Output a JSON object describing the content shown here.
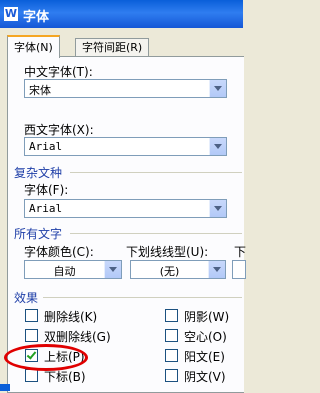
{
  "window": {
    "title": "字体",
    "app_icon": "W"
  },
  "tabs": [
    {
      "label": "字体(N)",
      "active": true
    },
    {
      "label": "字符间距(R)",
      "active": false
    }
  ],
  "fonts": {
    "chinese_label": "中文字体(T):",
    "chinese_value": "宋体",
    "western_label": "西文字体(X):",
    "western_value": "Arial"
  },
  "complex": {
    "section": "复杂文种",
    "font_label": "字体(F):",
    "font_value": "Arial"
  },
  "all_text": {
    "section": "所有文字",
    "color_label": "字体颜色(C):",
    "color_value": "自动",
    "underline_label": "下划线线型(U):",
    "underline_value": "(无)",
    "third_label": "下"
  },
  "effects": {
    "section": "效果",
    "left": [
      {
        "label": "删除线(K)",
        "checked": false
      },
      {
        "label": "双删除线(G)",
        "checked": false
      },
      {
        "label": "上标(P)",
        "checked": true
      },
      {
        "label": "下标(B)",
        "checked": false
      }
    ],
    "right": [
      {
        "label": "阴影(W)",
        "checked": false
      },
      {
        "label": "空心(O)",
        "checked": false
      },
      {
        "label": "阳文(E)",
        "checked": false
      },
      {
        "label": "阴文(V)",
        "checked": false
      }
    ]
  },
  "colors": {
    "title_bar": "#1a5ad8",
    "section": "#1f3fa8",
    "highlight_circle": "#e00000"
  }
}
